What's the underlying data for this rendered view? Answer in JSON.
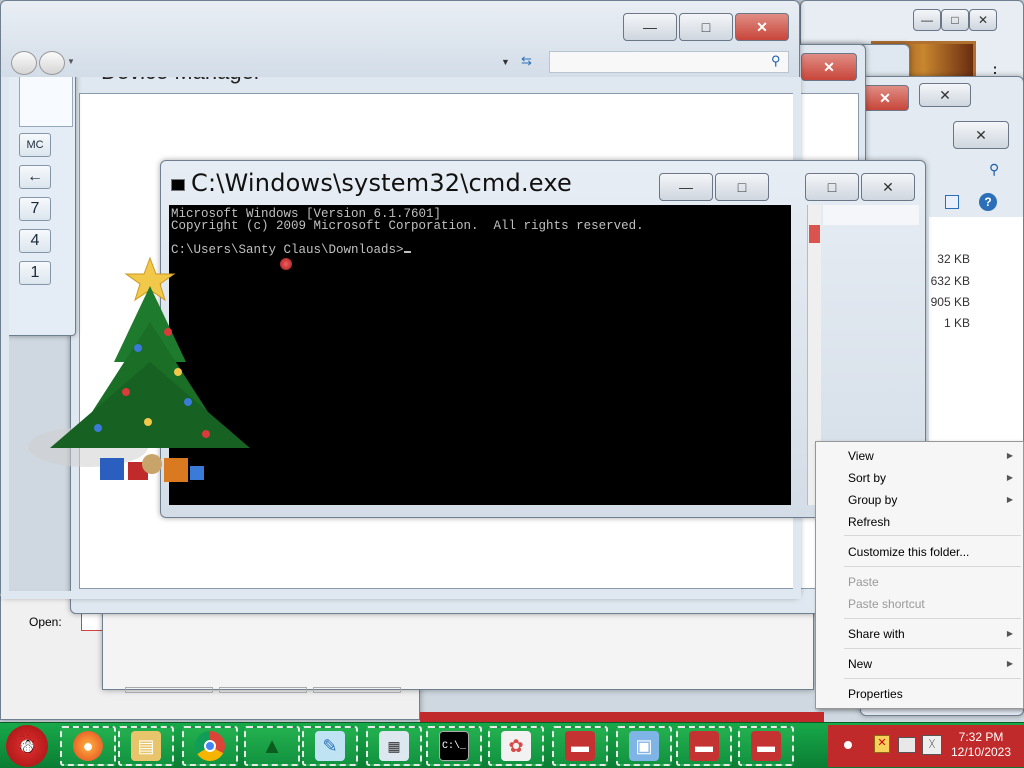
{
  "cmd": {
    "title": "C:\\Windows\\system32\\cmd.exe",
    "line1": "Microsoft Windows [Version 6.1.7601]",
    "line2": "Copyright (c) 2009 Microsoft Corporation.  All rights reserved.",
    "prompt": "C:\\Users\\Santy Claus\\Downloads>"
  },
  "device_manager": {
    "title": "Device Manager"
  },
  "calculator": {
    "keys": {
      "mc": "MC",
      "back": "←",
      "seven": "7",
      "four": "4",
      "one": "1"
    }
  },
  "run_dialog": {
    "open_label": "Open:"
  },
  "explorer": {
    "file_sizes": [
      "32 KB",
      "632 KB",
      "905 KB",
      "1 KB"
    ]
  },
  "context_menu": {
    "items": [
      {
        "label": "View",
        "submenu": true
      },
      {
        "label": "Sort by",
        "submenu": true
      },
      {
        "label": "Group by",
        "submenu": true
      },
      {
        "label": "Refresh",
        "submenu": false
      },
      {
        "label": "Customize this folder...",
        "submenu": false
      },
      {
        "label": "Paste",
        "submenu": false,
        "disabled": true
      },
      {
        "label": "Paste shortcut",
        "submenu": false,
        "disabled": true
      },
      {
        "label": "Share with",
        "submenu": true
      },
      {
        "label": "New",
        "submenu": true
      },
      {
        "label": "Properties",
        "submenu": false
      }
    ]
  },
  "clock": {
    "time": "7:32 PM",
    "date": "12/10/2023"
  },
  "taskbar": {
    "apps": [
      "firefox-icon",
      "file-explorer-icon",
      "chrome-icon",
      "christmas-tree-icon",
      "notepad-icon",
      "calculator-icon",
      "cmd-icon",
      "paint-icon",
      "toolbox-icon",
      "control-panel-icon",
      "toolbox-icon",
      "toolbox-icon"
    ]
  },
  "colors": {
    "taskbar": "#17a94a",
    "console_bg": "#000000",
    "close_button": "#c8453a"
  }
}
